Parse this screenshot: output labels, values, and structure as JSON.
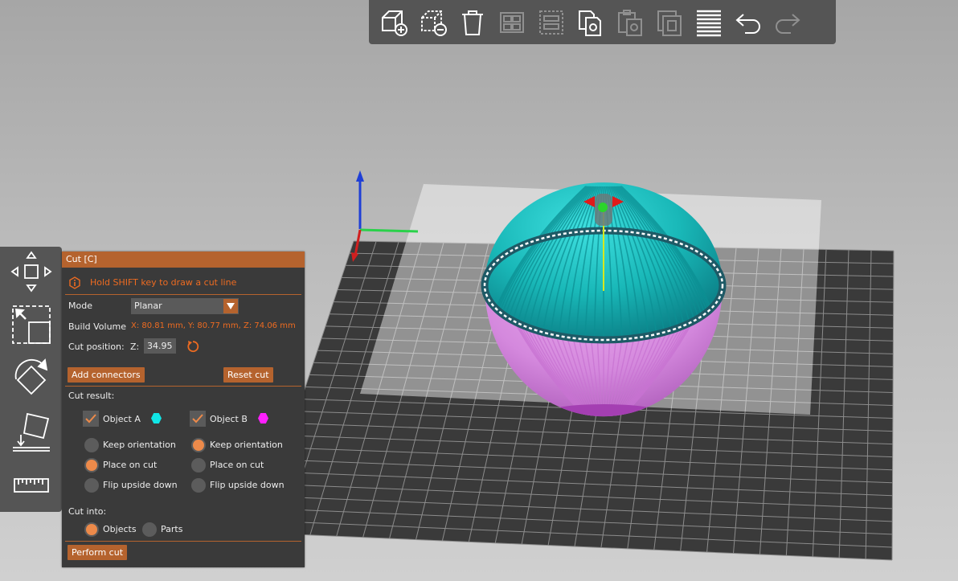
{
  "top_toolbar": {
    "buttons": [
      {
        "icon": "add-object-icon",
        "enabled": true
      },
      {
        "icon": "delete-object-icon",
        "enabled": true
      },
      {
        "icon": "delete-all-icon",
        "enabled": true
      },
      {
        "icon": "arrange-icon",
        "enabled": false
      },
      {
        "icon": "arrange-selection-icon",
        "enabled": false
      },
      {
        "icon": "copy-icon",
        "enabled": true
      },
      {
        "icon": "paste-icon",
        "enabled": false
      },
      {
        "icon": "instances-icon",
        "enabled": false
      },
      {
        "icon": "layers-editing-icon",
        "enabled": true
      },
      {
        "icon": "undo-icon",
        "enabled": true
      },
      {
        "icon": "redo-icon",
        "enabled": false
      }
    ]
  },
  "left_toolbar": {
    "tools": [
      "move-icon",
      "scale-icon",
      "rotate-icon",
      "place-on-face-icon",
      "measure-icon"
    ]
  },
  "cut_panel": {
    "title": "Cut [C]",
    "hint": "Hold SHIFT key to draw a cut line",
    "mode_label": "Mode",
    "mode_value": "Planar",
    "build_volume_label": "Build Volume",
    "build_volume_value": "X: 80.81 mm,  Y: 80.77 mm,  Z: 74.06 mm",
    "cut_position_label": "Cut position:",
    "z_label": "Z:",
    "z_value": "34.95",
    "add_connectors": "Add connectors",
    "reset_cut": "Reset cut",
    "cut_result_label": "Cut result:",
    "object_a": {
      "label": "Object A",
      "checked": true,
      "color": "#10e5e5",
      "options": [
        "Keep orientation",
        "Place on cut",
        "Flip upside down"
      ],
      "selected": "Place on cut"
    },
    "object_b": {
      "label": "Object B",
      "checked": true,
      "color": "#ff1fff",
      "options": [
        "Keep orientation",
        "Place on cut",
        "Flip upside down"
      ],
      "selected": "Keep orientation"
    },
    "cut_into_label": "Cut into:",
    "cut_into_options": [
      "Objects",
      "Parts"
    ],
    "cut_into_selected": "Objects",
    "perform_cut": "Perform cut"
  },
  "colors": {
    "accent": "#ed6b21",
    "title_bar": "#b5632e",
    "panel_bg": "#3a3a3a",
    "toolbar_bg": "#555555",
    "upper_part": "#17b9b9",
    "lower_part": "#d68ae0"
  }
}
